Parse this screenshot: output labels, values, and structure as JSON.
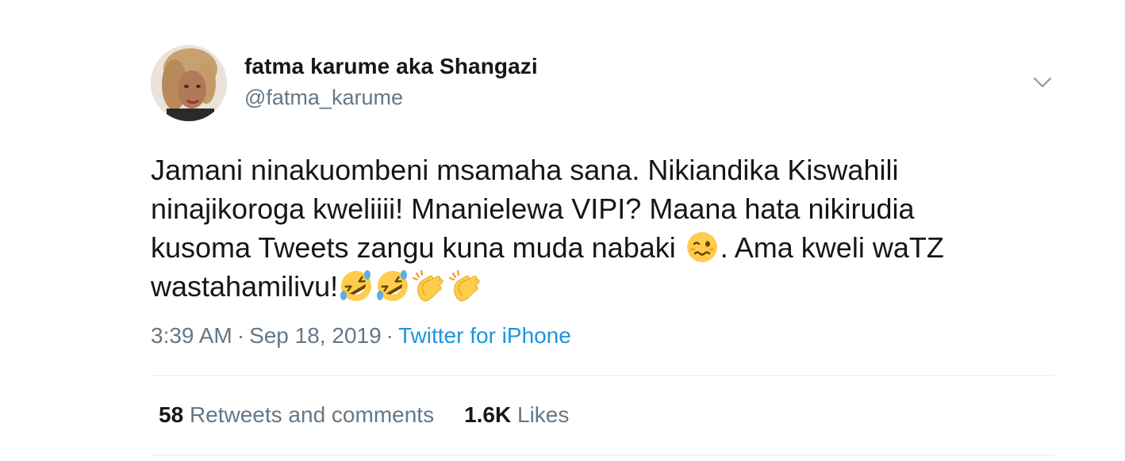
{
  "author": {
    "display_name": "fatma karume aka Shangazi",
    "handle": "@fatma_karume"
  },
  "tweet": {
    "lines": [
      "Jamani ninakuombeni msamaha sana. Nikiandika Kiswahili",
      "ninajikoroga kweliiii! Mnanielewa VIPI? Maana hata nikirudia",
      "kusoma Tweets zangu kuna muda nabaki",
      ". Ama kweli waTZ",
      "wastahamilivu!"
    ],
    "emojis": [
      "woozy-face-icon",
      "rolling-on-floor-laughing-icon",
      "rolling-on-floor-laughing-icon",
      "clapping-hands-icon",
      "clapping-hands-icon"
    ]
  },
  "meta": {
    "time": "3:39 AM",
    "separator": "·",
    "date": "Sep 18, 2019",
    "source": "Twitter for iPhone"
  },
  "stats": {
    "retweets_count": "58",
    "retweets_label": "Retweets and comments",
    "likes_count": "1.6K",
    "likes_label": "Likes"
  },
  "colors": {
    "text": "#14171a",
    "secondary": "#657786",
    "link": "#1b95e0",
    "divider": "#e6ecf0"
  }
}
